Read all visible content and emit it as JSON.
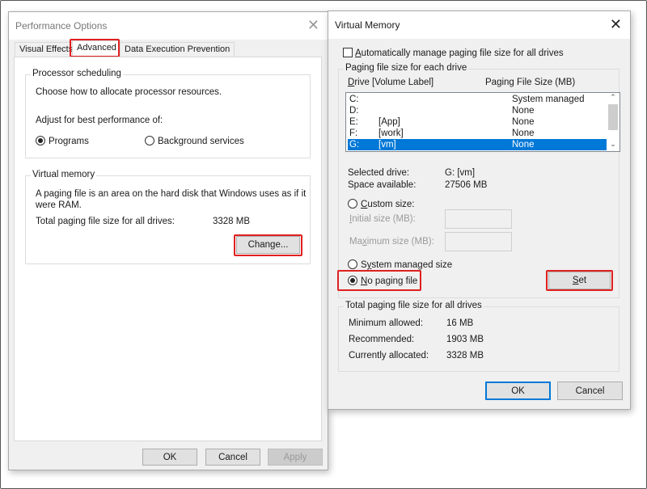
{
  "perf": {
    "title": "Performance Options",
    "tabs": [
      {
        "label": "Visual Effects"
      },
      {
        "label": "Advanced"
      },
      {
        "label": "Data Execution Prevention"
      }
    ],
    "processor": {
      "title": "Processor scheduling",
      "desc": "Choose how to allocate processor resources.",
      "adjust": "Adjust for best performance of:",
      "opt_programs": "Programs",
      "opt_background": "Background services"
    },
    "vm": {
      "title": "Virtual memory",
      "desc1": "A paging file is an area on the hard disk that Windows uses as if it",
      "desc2": "were RAM.",
      "total_label": "Total paging file size for all drives:",
      "total_value": "3328 MB",
      "change": "Change..."
    },
    "ok": "OK",
    "cancel": "Cancel",
    "apply": "Apply"
  },
  "vmdlg": {
    "title": "Virtual Memory",
    "auto_label_u": "A",
    "auto_label_rest": "utomatically manage paging file size for all drives",
    "group_title": "Paging file size for each drive",
    "col_drive_u": "D",
    "col_drive_rest": "rive  [Volume Label]",
    "col_size": "Paging File Size (MB)",
    "drives": [
      {
        "drive": "C:",
        "label": "",
        "size": "System managed"
      },
      {
        "drive": "D:",
        "label": "",
        "size": "None"
      },
      {
        "drive": "E:",
        "label": "[App]",
        "size": "None"
      },
      {
        "drive": "F:",
        "label": "[work]",
        "size": "None"
      },
      {
        "drive": "G:",
        "label": "[vm]",
        "size": "None"
      }
    ],
    "selected_label": "Selected drive:",
    "selected_value": "G:  [vm]",
    "space_label": "Space available:",
    "space_value": "27506 MB",
    "custom_u": "C",
    "custom_rest": "ustom size:",
    "initial_u": "I",
    "initial_rest": "nitial size (MB):",
    "max_pre": "Ma",
    "max_u": "x",
    "max_rest": "imum size (MB):",
    "sys_pre": "S",
    "sys_u": "y",
    "sys_rest": "stem managed size",
    "nopage_u": "N",
    "nopage_rest": "o paging file",
    "set_u": "S",
    "set_rest": "et",
    "totals_title": "Total paging file size for all drives",
    "min_label": "Minimum allowed:",
    "min_value": "16 MB",
    "rec_label": "Recommended:",
    "rec_value": "1903 MB",
    "cur_label": "Currently allocated:",
    "cur_value": "3328 MB",
    "ok": "OK",
    "cancel": "Cancel"
  }
}
